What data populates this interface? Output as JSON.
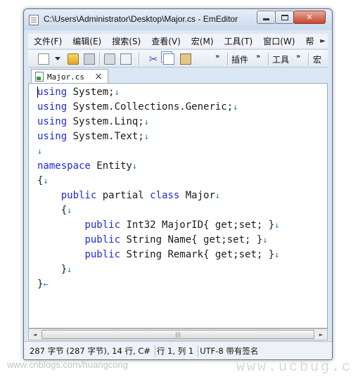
{
  "window": {
    "title": "C:\\Users\\Administrator\\Desktop\\Major.cs - EmEditor",
    "close_glyph": "✕"
  },
  "menubar": {
    "items": [
      {
        "label": "文件(F)"
      },
      {
        "label": "编辑(E)"
      },
      {
        "label": "搜索(S)"
      },
      {
        "label": "查看(V)"
      },
      {
        "label": "宏(M)"
      },
      {
        "label": "工具(T)"
      },
      {
        "label": "窗口(W)"
      },
      {
        "label": "帮"
      }
    ],
    "overflow_glyph": "►"
  },
  "toolbar": {
    "icons": [
      "new-file-icon",
      "open-folder-icon",
      "save-icon",
      "print-icon",
      "print-preview-icon",
      "cut-icon",
      "copy-icon",
      "paste-icon"
    ],
    "cut_glyph": "✂",
    "chevron": "»",
    "macro_label": "插件",
    "tools_label": "工具",
    "window_label": "宏"
  },
  "tab": {
    "label": "Major.cs",
    "close_glyph": "×"
  },
  "editor": {
    "eol_glyph": "↓",
    "eof_glyph": "←",
    "lines": [
      {
        "indent": "",
        "kw": "using",
        "text": " System;",
        "end": "↓"
      },
      {
        "indent": "",
        "kw": "using",
        "text": " System.Collections.Generic;",
        "end": "↓"
      },
      {
        "indent": "",
        "kw": "using",
        "text": " System.Linq;",
        "end": "↓"
      },
      {
        "indent": "",
        "kw": "using",
        "text": " System.Text;",
        "end": "↓"
      },
      {
        "indent": "",
        "kw": "",
        "text": "",
        "end": "↓"
      },
      {
        "indent": "",
        "kw": "namespace",
        "text": " Entity",
        "end": "↓"
      },
      {
        "indent": "",
        "kw": "",
        "text": "{",
        "end": "↓"
      },
      {
        "indent": "    ",
        "kw": "public",
        "text": " partial ",
        "kw2": "class",
        "text2": " Major",
        "end": "↓"
      },
      {
        "indent": "    ",
        "kw": "",
        "text": "{",
        "end": "↓"
      },
      {
        "indent": "        ",
        "kw": "public",
        "text": " Int32 MajorID{ get;set; }",
        "end": "↓"
      },
      {
        "indent": "        ",
        "kw": "public",
        "text": " String Name{ get;set; }",
        "end": "↓"
      },
      {
        "indent": "        ",
        "kw": "public",
        "text": " String Remark{ get;set; }",
        "end": "↓"
      },
      {
        "indent": "    ",
        "kw": "",
        "text": "}",
        "end": "↓"
      },
      {
        "indent": "",
        "kw": "",
        "text": "}",
        "end": "←"
      }
    ]
  },
  "scrollbar": {
    "left_glyph": "◄",
    "right_glyph": "►",
    "thumb_glyph": "|||"
  },
  "statusbar": {
    "size": "287 字节 (287 字节), 14 行, C#",
    "position": "行 1, 列 1",
    "encoding": "UTF-8 带有签名"
  },
  "watermarks": {
    "left": "www.cnblogs.com/huangcong",
    "right": "www.ucbug.c"
  },
  "colors": {
    "keyword": "#1f2bd6",
    "eol_marker": "#1e78d8"
  }
}
